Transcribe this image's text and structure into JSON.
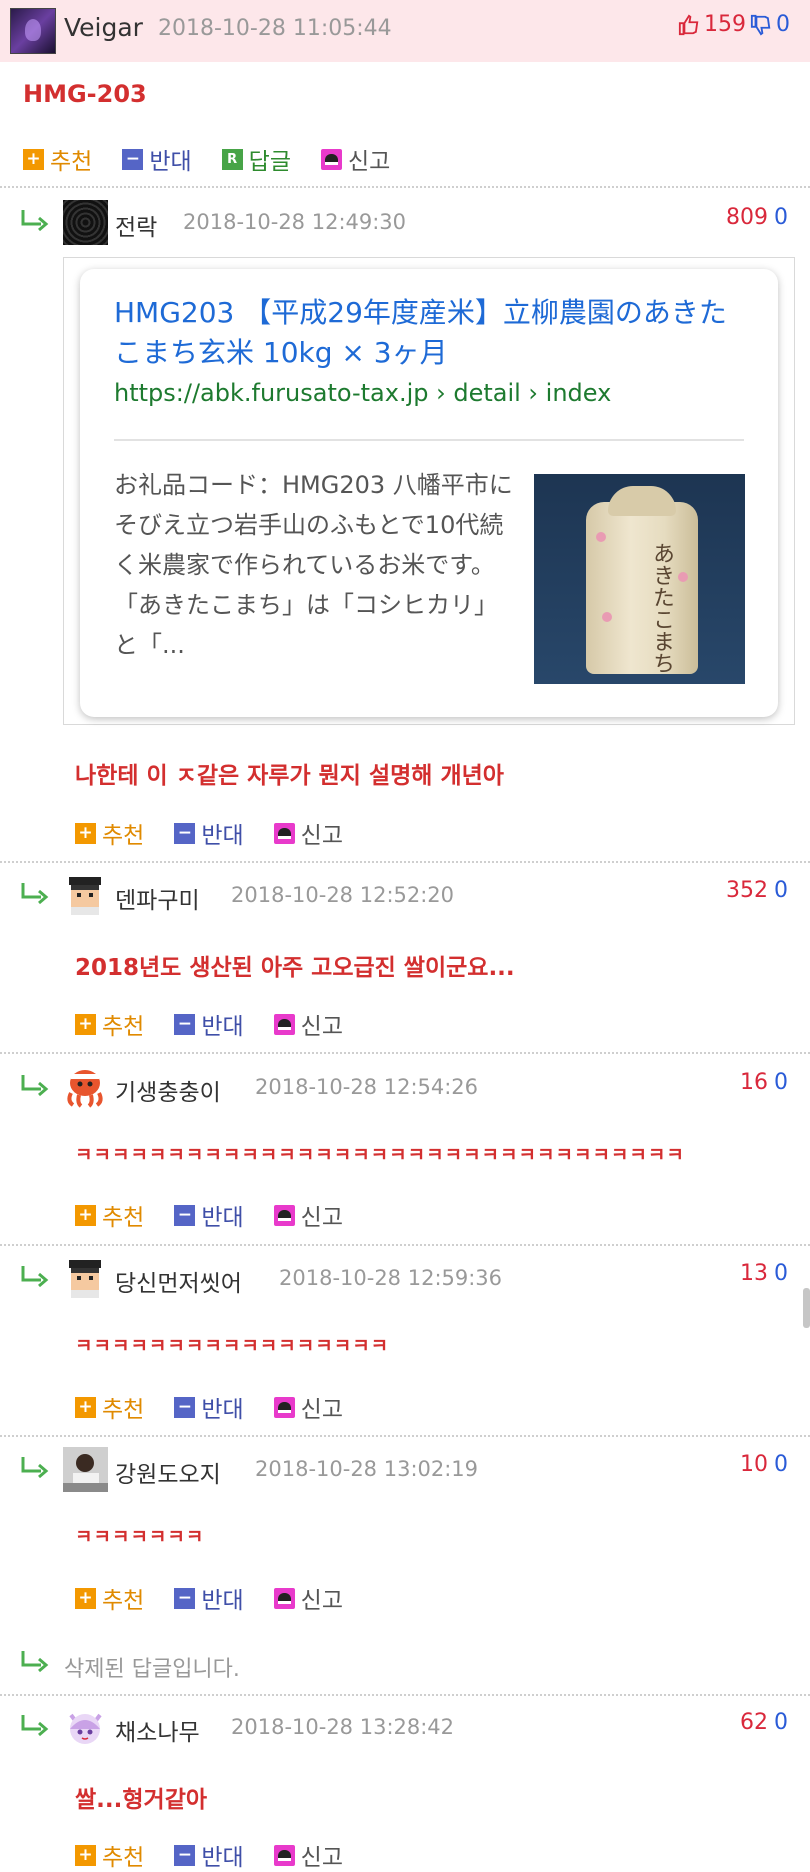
{
  "post": {
    "author": "Veigar",
    "date": "2018-10-28 11:05:44",
    "upvotes": "159",
    "downvotes": "0",
    "title": "HMG-203",
    "actions": {
      "recommend": "추천",
      "oppose": "반대",
      "reply": "답글",
      "report": "신고"
    }
  },
  "link_preview": {
    "title": "HMG203 【平成29年度産米】立柳農園のあきたこまち玄米 10kg × 3ヶ月",
    "url": "https://abk.furusato-tax.jp › detail › index",
    "description": "お礼品コード：HMG203 八幡平市にそびえ立つ岩手山のふもとで10代続く米農家で作られているお米です。「あきたこまち」は「コシヒカリ」と「...",
    "image_text": "あきたこまち"
  },
  "comment_actions": {
    "recommend": "추천",
    "oppose": "반대",
    "report": "신고"
  },
  "comments": [
    {
      "author": "전락",
      "date": "2018-10-28 12:49:30",
      "up": "809",
      "down": "0",
      "text": "나한테 이 ㅈ같은 자루가 뭔지 설명해 개년아"
    },
    {
      "author": "덴파구미",
      "date": "2018-10-28 12:52:20",
      "up": "352",
      "down": "0",
      "text": "2018년도 생산된 아주 고오급진 쌀이군요..."
    },
    {
      "author": "기생충충이",
      "date": "2018-10-28 12:54:26",
      "up": "16",
      "down": "0",
      "text": "ㅋㅋㅋㅋㅋㅋㅋㅋㅋㅋㅋㅋㅋㅋㅋㅋㅋㅋㅋㅋㅋㅋㅋㅋㅋㅋㅋㅋㅋㅋㅋㅋㅋ"
    },
    {
      "author": "당신먼저씻어",
      "date": "2018-10-28 12:59:36",
      "up": "13",
      "down": "0",
      "text": "ㅋㅋㅋㅋㅋㅋㅋㅋㅋㅋㅋㅋㅋㅋㅋㅋㅋ"
    },
    {
      "author": "강원도오지",
      "date": "2018-10-28 13:02:19",
      "up": "10",
      "down": "0",
      "text": "ㅋㅋㅋㅋㅋㅋㅋ"
    },
    {
      "author": "채소나무",
      "date": "2018-10-28 13:28:42",
      "up": "62",
      "down": "0",
      "text": "쌀...형거같아"
    }
  ],
  "deleted_reply": "삭제된 답글입니다.",
  "colors": {
    "header_bg": "#fde7ea",
    "accent_red": "#d32f2f",
    "link_blue": "#1e6ad6",
    "url_green": "#1d7a2f"
  }
}
